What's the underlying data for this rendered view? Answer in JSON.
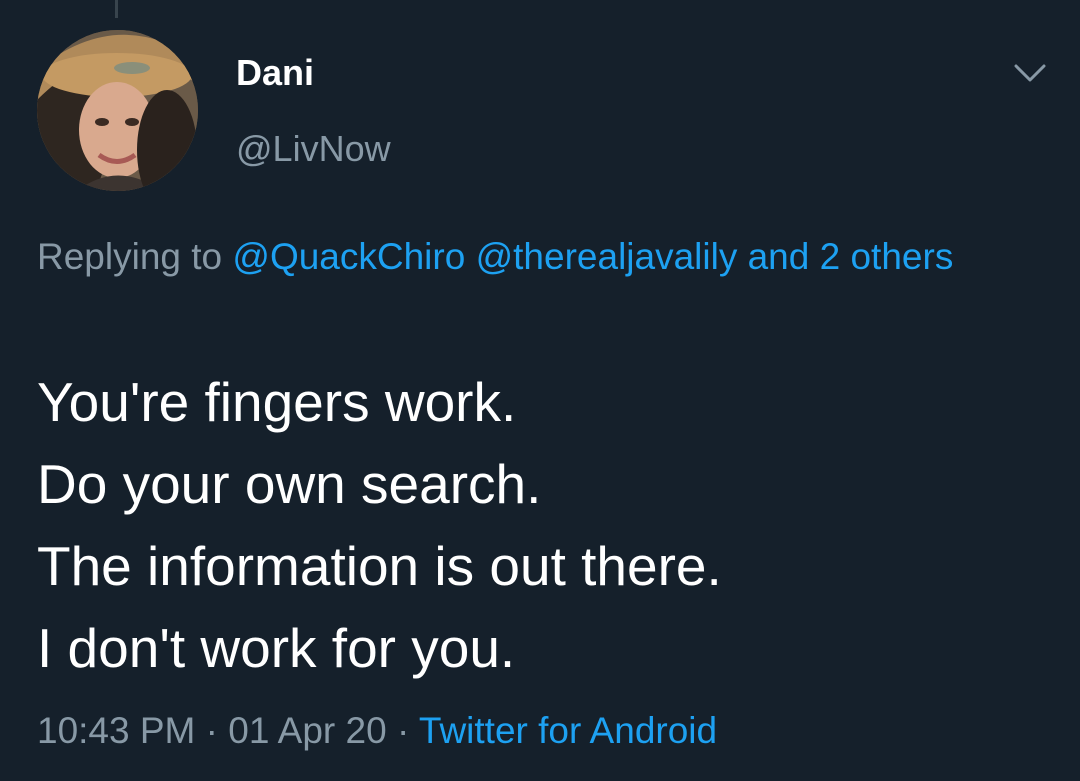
{
  "tweet": {
    "display_name": "Dani",
    "handle": "@LivNow",
    "reply_prefix": "Replying to",
    "mentions": [
      "@QuackChiro",
      "@therealjavalily"
    ],
    "and_others": "and 2 others",
    "lines": [
      "You're fingers work.",
      "Do your own search.",
      "The information is out there.",
      "I don't work for you."
    ],
    "time": "10:43 PM",
    "separator": "·",
    "date": "01 Apr 20",
    "source": "Twitter for Android"
  },
  "icons": {
    "menu": "chevron-down-icon",
    "avatar": "user-avatar"
  },
  "colors": {
    "background": "#15202b",
    "text": "#ffffff",
    "secondary_text": "#8899a6",
    "link": "#1da1f2"
  }
}
